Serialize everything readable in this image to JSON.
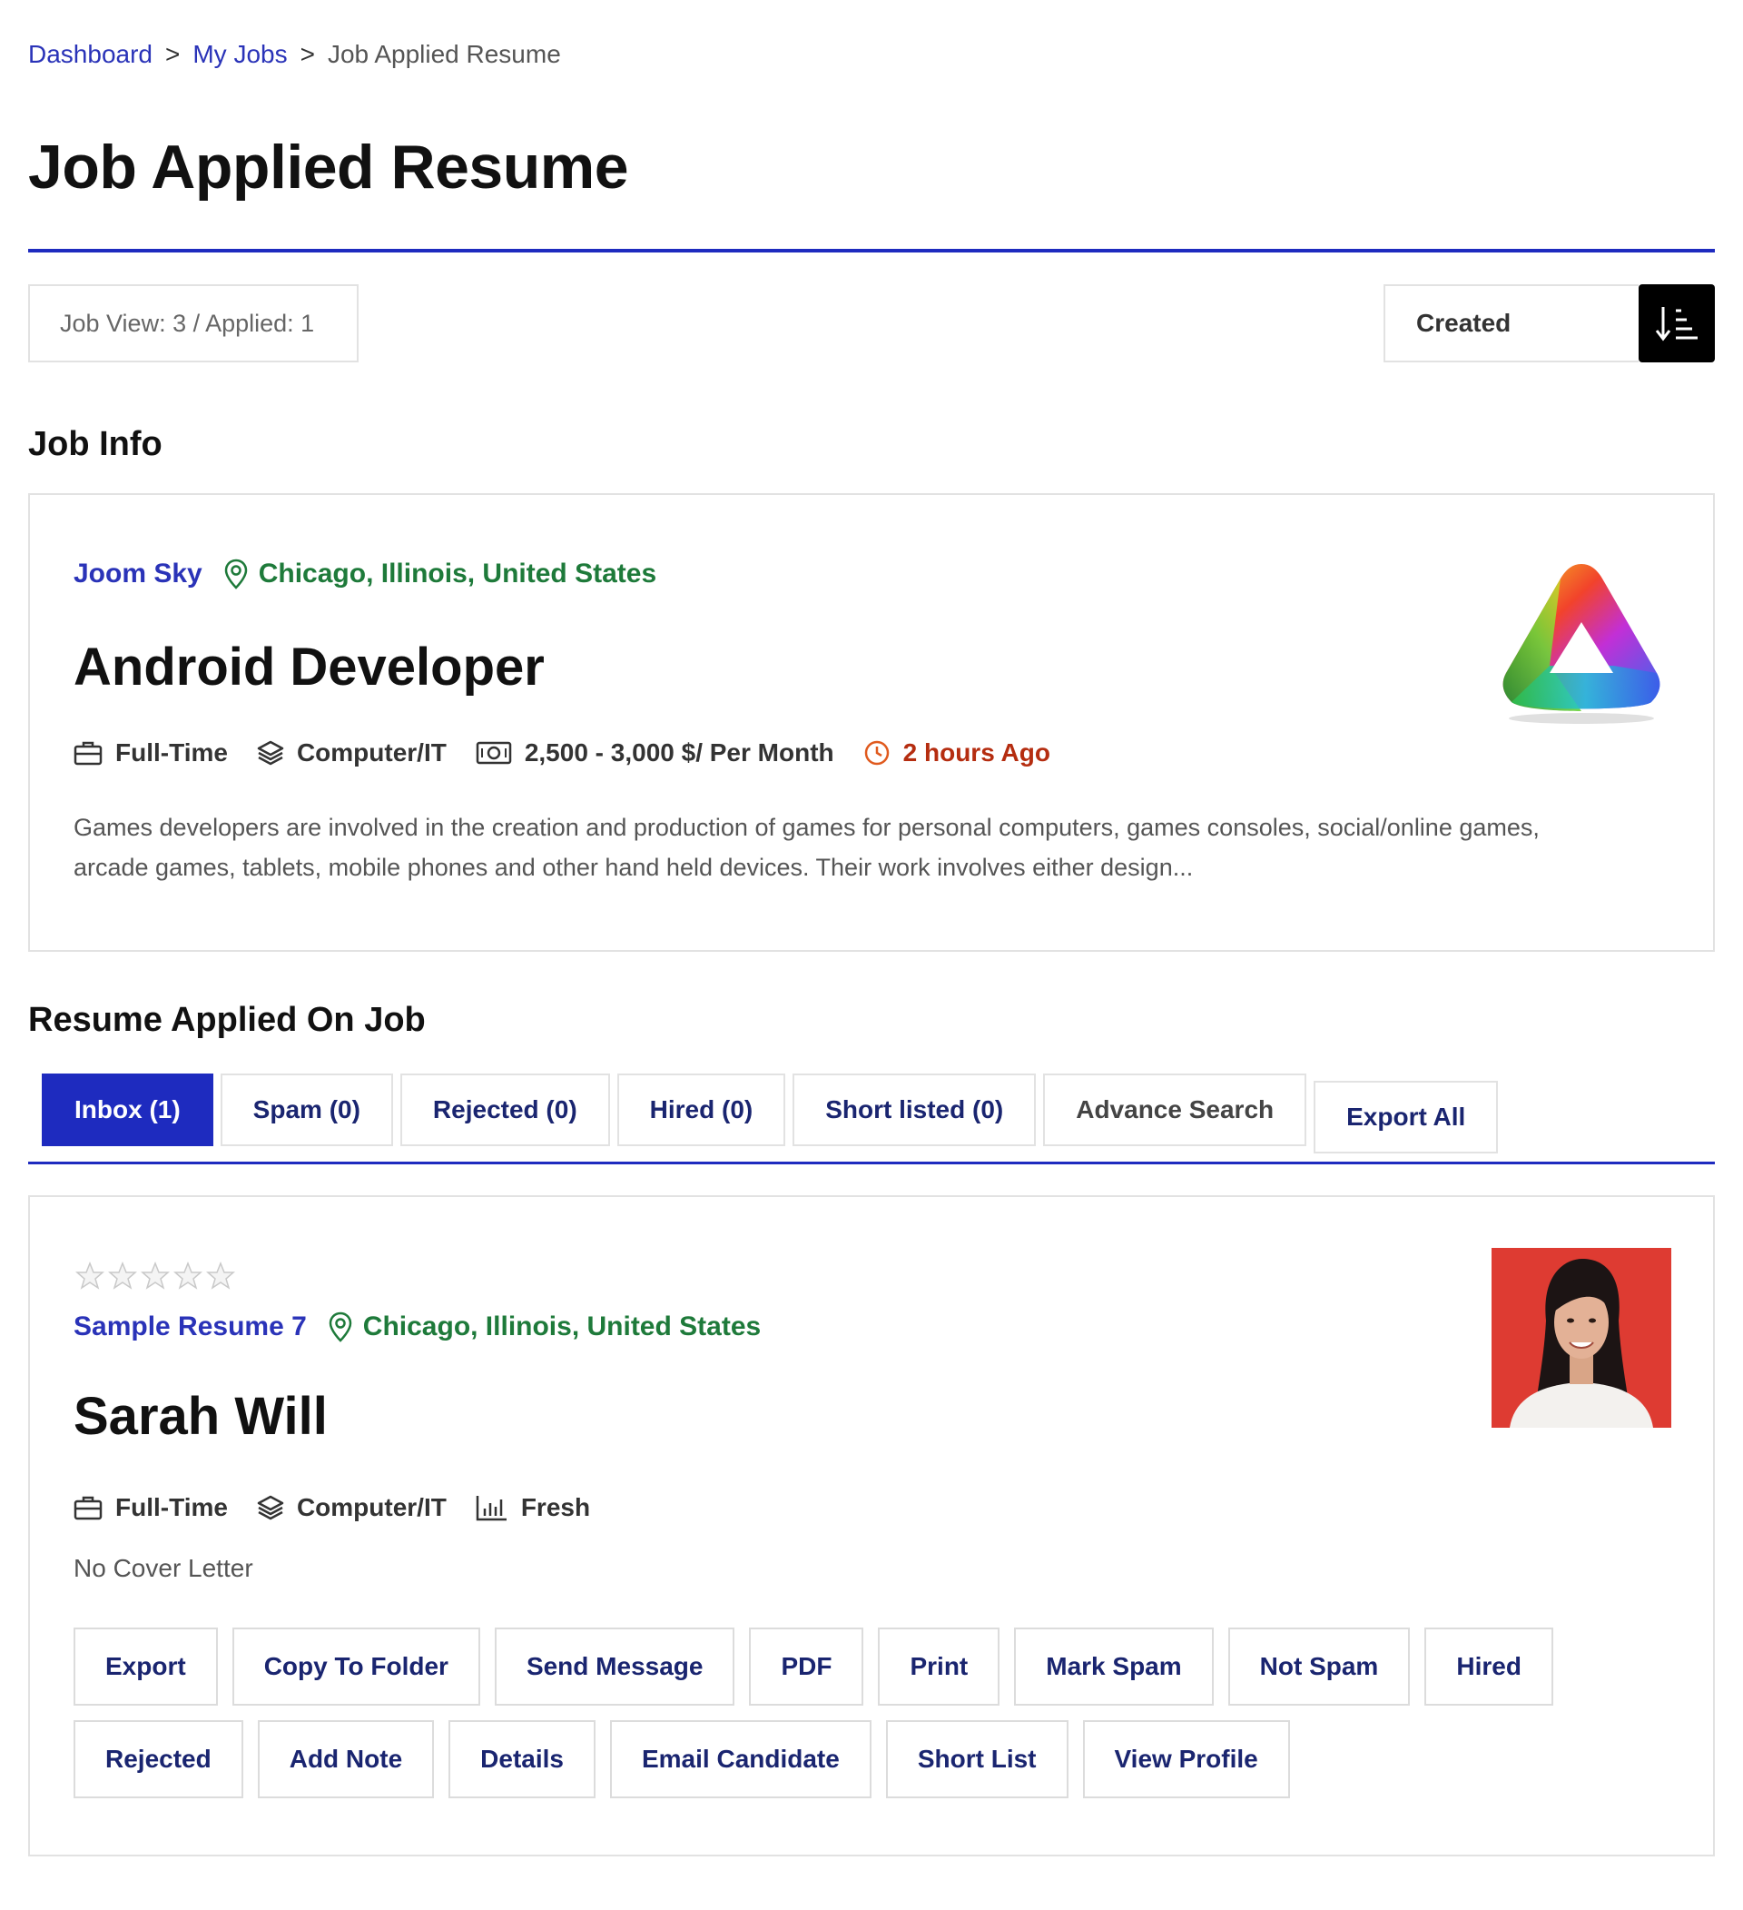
{
  "breadcrumb": {
    "items": [
      "Dashboard",
      "My Jobs"
    ],
    "current": "Job Applied Resume",
    "separator": ">"
  },
  "page": {
    "title": "Job Applied Resume"
  },
  "stats": {
    "text": "Job View: 3 / Applied: 1"
  },
  "sort": {
    "selected": "Created",
    "button_icon": "sort-descending-icon"
  },
  "job_info": {
    "heading": "Job Info",
    "company": "Joom Sky",
    "location": "Chicago, Illinois, United States",
    "title": "Android Developer",
    "job_type": "Full-Time",
    "category": "Computer/IT",
    "salary": "2,500 - 3,000 $/ Per Month",
    "posted": "2 hours Ago",
    "description": "Games developers are involved in the creation and production of games for personal computers, games consoles, social/online games, arcade games, tablets, mobile phones and other hand held devices. Their work involves either design..."
  },
  "resumes_section": {
    "heading": "Resume Applied On Job",
    "tabs": [
      {
        "label": "Inbox (1)",
        "active": true
      },
      {
        "label": "Spam (0)"
      },
      {
        "label": "Rejected (0)"
      },
      {
        "label": "Hired (0)"
      },
      {
        "label": "Short listed (0)"
      },
      {
        "label": "Advance Search"
      },
      {
        "label": "Export All"
      }
    ]
  },
  "resume": {
    "rating": 0,
    "rating_max": 5,
    "resume_title": "Sample Resume 7",
    "location": "Chicago, Illinois, United States",
    "name": "Sarah Will",
    "job_type": "Full-Time",
    "category": "Computer/IT",
    "experience": "Fresh",
    "cover_letter": "No Cover Letter",
    "actions_row1": [
      "Export",
      "Copy To Folder",
      "Send Message",
      "PDF",
      "Print",
      "Mark Spam",
      "Not Spam",
      "Hired"
    ],
    "actions_row2": [
      "Rejected",
      "Add Note",
      "Details",
      "Email Candidate",
      "Short List",
      "View Profile"
    ]
  },
  "colors": {
    "accent": "#1e2bbf",
    "link": "#2a33b8",
    "location": "#1e7a3a",
    "time": "#b52d10",
    "photo_bg": "#de3b32"
  }
}
